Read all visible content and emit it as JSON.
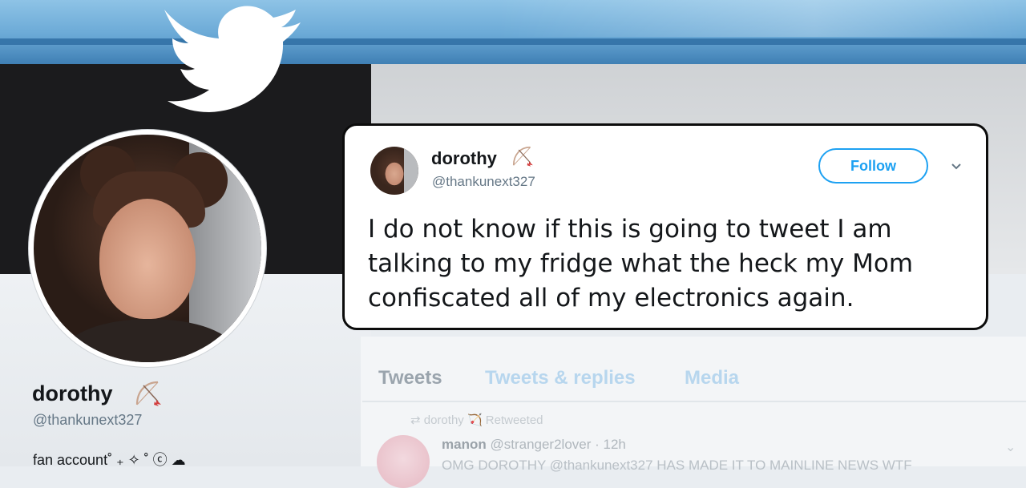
{
  "colors": {
    "twitter_blue": "#1da1f2",
    "handle_gray": "#657786",
    "text_dark": "#14171a"
  },
  "icons": [
    "twitter-bird-icon",
    "bow-and-arrow-icon",
    "chevron-down-icon",
    "retweet-icon"
  ],
  "profile": {
    "name": "dorothy",
    "handle": "@thankunext327",
    "bio": "fan account˚ ₊ ✧ ˚ ⓒ ☁"
  },
  "timeline": {
    "tabs": [
      "Tweets",
      "Tweets & replies",
      "Media"
    ],
    "retweeted_label": "dorothy 🏹 Retweeted",
    "item": {
      "name": "manon",
      "handle_time": "@stranger2lover · 12h",
      "text": "OMG DOROTHY @thankunext327 HAS MADE IT TO MAINLINE NEWS WTF"
    }
  },
  "tweet": {
    "name": "dorothy",
    "handle": "@thankunext327",
    "follow_label": "Follow",
    "text": "I do not know if this is going to tweet I am talking to my fridge what the heck my Mom confiscated all of my electronics again."
  }
}
